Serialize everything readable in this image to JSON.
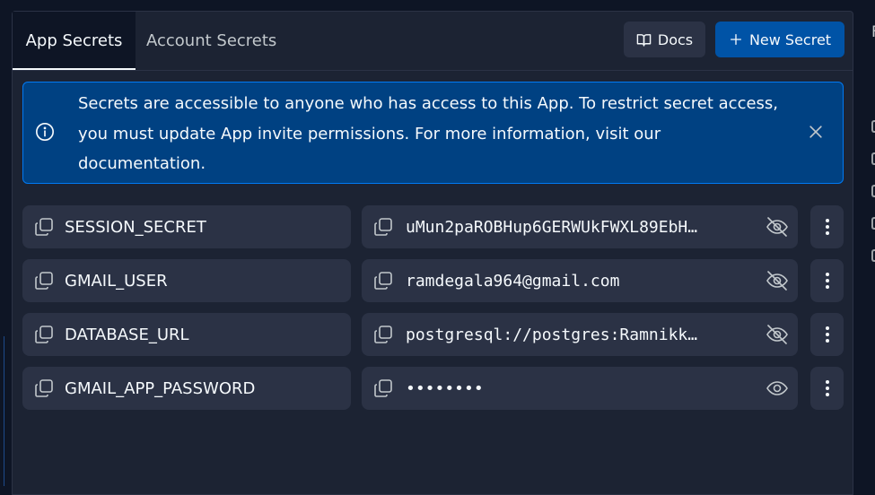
{
  "tabs": [
    {
      "label": "App Secrets",
      "active": true
    },
    {
      "label": "Account Secrets",
      "active": false
    }
  ],
  "actions": {
    "docs_label": "Docs",
    "new_secret_label": "New Secret"
  },
  "banner": {
    "text": "Secrets are accessible to anyone who has access to this App. To restrict secret access, you must update App invite permissions. For more information, visit our documentation."
  },
  "secrets": [
    {
      "key": "SESSION_SECRET",
      "value": "uMun2paROBHup6GERWUkFWXL89EbH…",
      "visible": true
    },
    {
      "key": "GMAIL_USER",
      "value": "ramdegala964@gmail.com",
      "visible": true
    },
    {
      "key": "DATABASE_URL",
      "value": "postgresql://postgres:Ramnikk…",
      "visible": true
    },
    {
      "key": "GMAIL_APP_PASSWORD",
      "value": "••••••••",
      "visible": false
    }
  ],
  "colors": {
    "background": "#1c2333",
    "cell": "#2b3245",
    "banner": "#004182",
    "primary_button": "#0053a6"
  },
  "icons": [
    "book-icon",
    "plus-icon",
    "info-icon",
    "close-icon",
    "copy-icon",
    "eye-off-icon",
    "eye-icon",
    "more-vertical-icon"
  ],
  "edge": {
    "char": "F"
  }
}
